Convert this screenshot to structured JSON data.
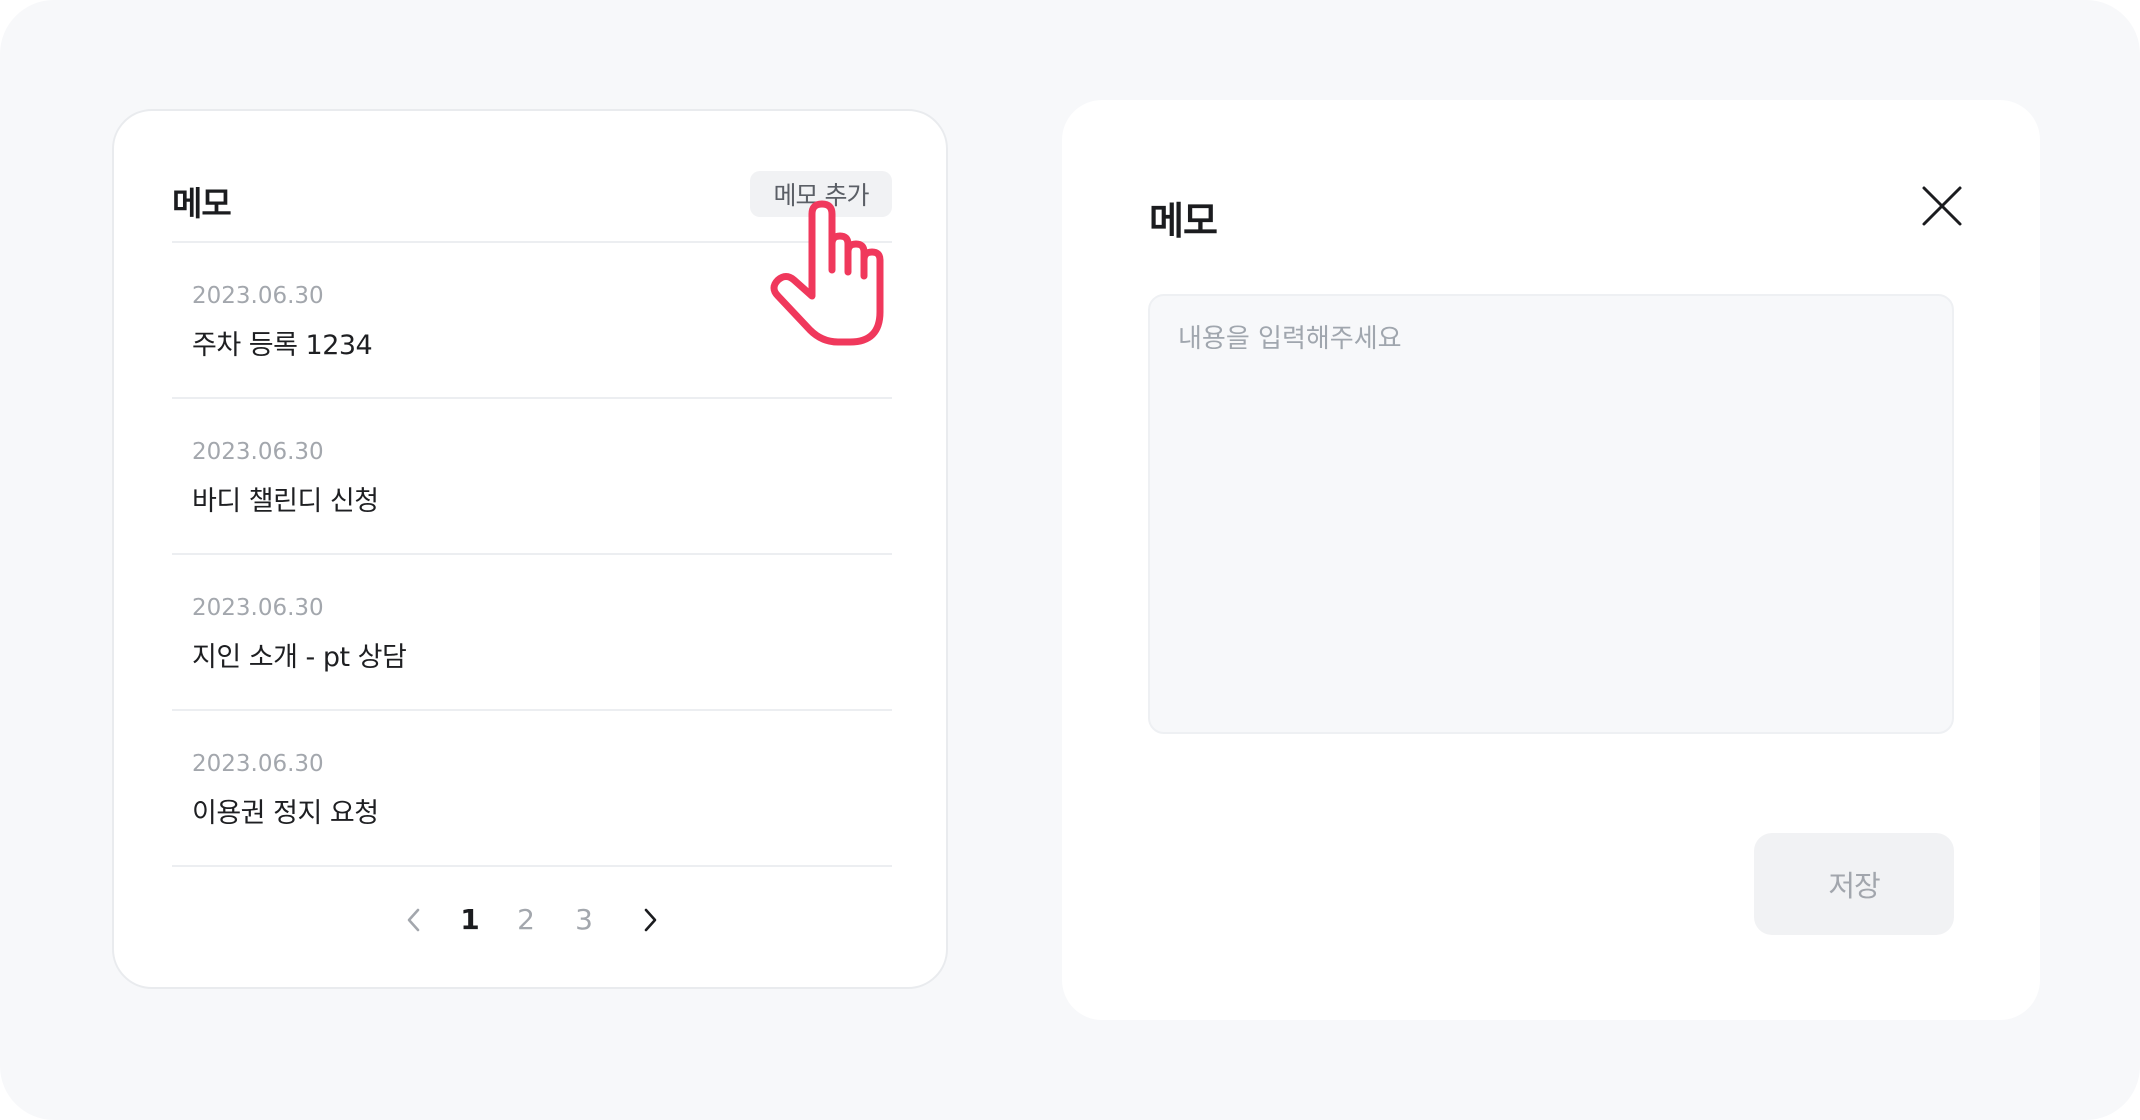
{
  "memo_list": {
    "title": "메모",
    "add_button_label": "메모 추가",
    "items": [
      {
        "date": "2023.06.30",
        "text": "주차 등록 1234"
      },
      {
        "date": "2023.06.30",
        "text": "바디 챌린디 신청"
      },
      {
        "date": "2023.06.30",
        "text": "지인 소개 - pt 상담"
      },
      {
        "date": "2023.06.30",
        "text": "이용권 정지 요청"
      }
    ],
    "pagination": {
      "pages": [
        "1",
        "2",
        "3"
      ],
      "current": "1"
    }
  },
  "memo_editor": {
    "title": "메모",
    "placeholder": "내용을 입력해주세요",
    "save_label": "저장"
  },
  "colors": {
    "background": "#f7f8fa",
    "card": "#ffffff",
    "pointer_hand": "#f0385c",
    "text_primary": "#1b1c1f",
    "text_muted": "#a3a7ad"
  },
  "icons": [
    "chevron-left-icon",
    "chevron-right-icon",
    "close-icon",
    "pointer-hand-icon"
  ]
}
